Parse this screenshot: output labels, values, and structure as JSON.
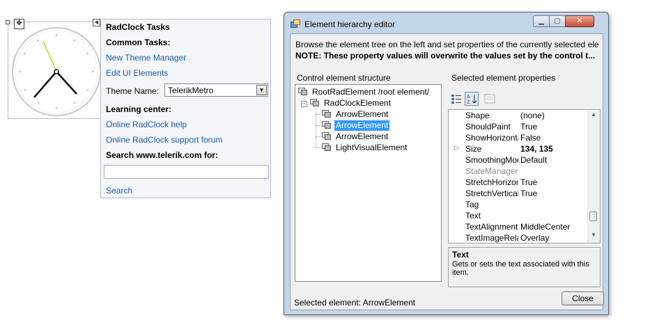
{
  "clock": {
    "move_glyph": "✥",
    "smart_tag_glyph": "◀"
  },
  "tasks": {
    "title": "RadClock Tasks",
    "common_tasks_header": "Common Tasks:",
    "new_theme_manager": "New Theme Manager",
    "edit_ui_elements": "Edit UI Elements",
    "theme_name_label": "Theme Name:",
    "theme_value": "TelerikMetro",
    "learning_center_header": "Learning center:",
    "help_link": "Online RadClock help",
    "forum_link": "Online RadClock support forum",
    "search_label": "Search www.telerik.com for:",
    "search_value": "",
    "search_link": "Search"
  },
  "dialog": {
    "title": "Element hierarchy editor",
    "caption": {
      "minimize": "▁",
      "maximize": "▢",
      "close": "✕"
    },
    "browse_text": "Browse the element tree on the left and set properties of the currently selected element in t...",
    "note_text": "NOTE: These property values will overwrite the values set by the control t...",
    "tree_group_label": "Control element structure",
    "tree": [
      {
        "label": "RootRadElement /root element/",
        "selected": false
      },
      {
        "label": "RadClockElement",
        "selected": false
      },
      {
        "label": "ArrowElement",
        "selected": false
      },
      {
        "label": "ArrowElement",
        "selected": true
      },
      {
        "label": "ArrowElement",
        "selected": false
      },
      {
        "label": "LightVisualElement",
        "selected": false
      }
    ],
    "props_group_label": "Selected element properties",
    "properties": [
      {
        "name": "Shape",
        "value": "(none)"
      },
      {
        "name": "ShouldPaint",
        "value": "True"
      },
      {
        "name": "ShowHorizontal",
        "value": "False"
      },
      {
        "name": "Size",
        "value": "134, 135",
        "expand": "▷"
      },
      {
        "name": "SmoothingMode",
        "value": "Default"
      },
      {
        "name": "StateManager",
        "value": ""
      },
      {
        "name": "StretchHorizontally",
        "value": "True"
      },
      {
        "name": "StretchVertically",
        "value": "True"
      },
      {
        "name": "Tag",
        "value": ""
      },
      {
        "name": "Text",
        "value": ""
      },
      {
        "name": "TextAlignment",
        "value": "MiddleCenter"
      },
      {
        "name": "TextImageRelation",
        "value": "Overlay"
      }
    ],
    "help_title": "Text",
    "help_description": "Gets or sets the text associated with this item.",
    "status_text": "Selected element: ArrowElement",
    "close_label": "Close"
  },
  "colors": {
    "link": "#1c58a8",
    "selection": "#3399ff",
    "title_bar": "#c4d6ea"
  }
}
